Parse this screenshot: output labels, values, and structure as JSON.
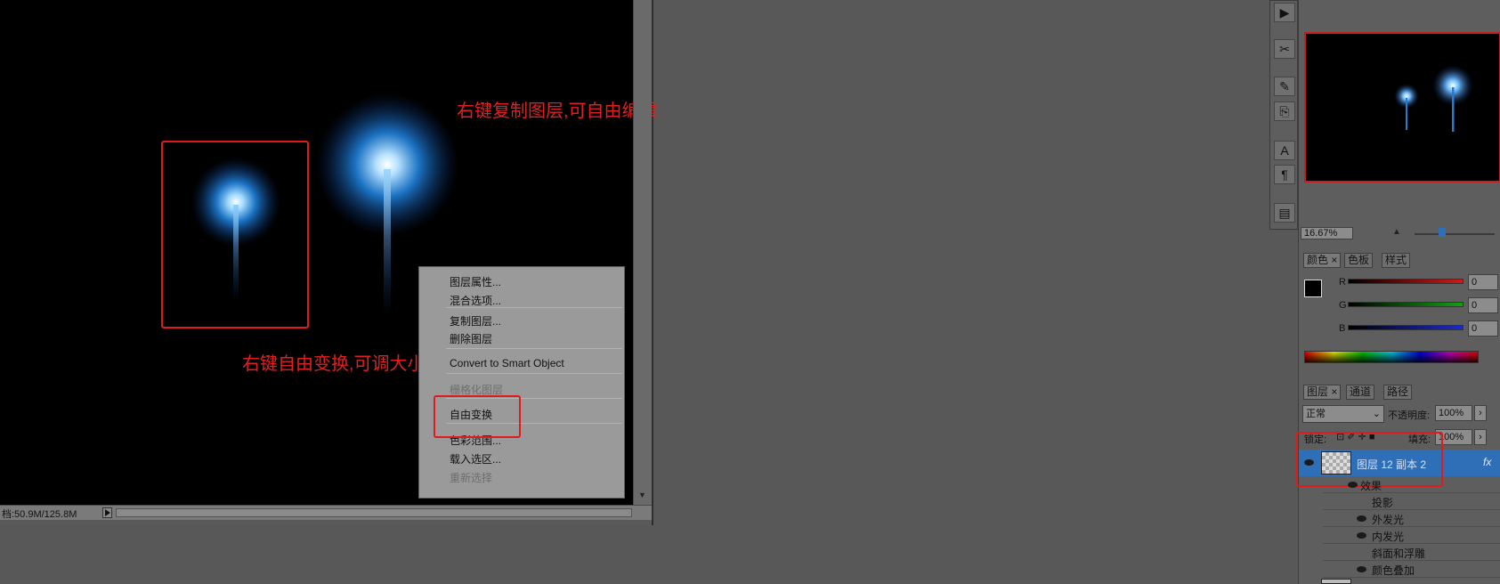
{
  "annotations": {
    "copy_layer": "右键复制图层,可自由编辑",
    "free_transform": "右键自由变换,可调大小"
  },
  "status_bar": {
    "doc_size": "档:50.9M/125.8M"
  },
  "context_menu": {
    "items": [
      {
        "label": "图层属性...",
        "disabled": false
      },
      {
        "label": "混合选项...",
        "disabled": false
      },
      {
        "label": "复制图层...",
        "disabled": false
      },
      {
        "label": "删除图层",
        "disabled": false
      },
      {
        "label": "Convert to Smart Object",
        "disabled": false
      },
      {
        "label": "栅格化图层",
        "disabled": true
      },
      {
        "label": "自由变换",
        "disabled": false
      },
      {
        "label": "色彩范围...",
        "disabled": false
      },
      {
        "label": "载入选区...",
        "disabled": false
      },
      {
        "label": "重新选择",
        "disabled": true
      }
    ]
  },
  "navigator": {
    "zoom": "16.67%"
  },
  "color_panel": {
    "tabs": [
      "颜色",
      "色板",
      "样式"
    ],
    "channels": [
      {
        "name": "R",
        "value": "0",
        "color": "#d01818"
      },
      {
        "name": "G",
        "value": "0",
        "color": "#14a014"
      },
      {
        "name": "B",
        "value": "0",
        "color": "#1a2ad0"
      }
    ]
  },
  "layers_panel": {
    "tabs": [
      "图层",
      "通道",
      "路径"
    ],
    "blend_mode": "正常",
    "opacity_label": "不透明度:",
    "opacity": "100%",
    "lock_label": "锁定:",
    "fill_label": "填充:",
    "fill": "100%",
    "selected_layer": "图层 12 副本 2",
    "fx": "fx",
    "effects_label": "效果",
    "effects": [
      {
        "label": "投影",
        "visible": false
      },
      {
        "label": "外发光",
        "visible": true
      },
      {
        "label": "内发光",
        "visible": true
      },
      {
        "label": "斜面和浮雕",
        "visible": false
      },
      {
        "label": "颜色叠加",
        "visible": true
      }
    ]
  },
  "colors": {
    "annotation_red": "#e21a1a",
    "selection_blue": "#2f6fb8",
    "firework_blue": "#1e7fd8"
  }
}
